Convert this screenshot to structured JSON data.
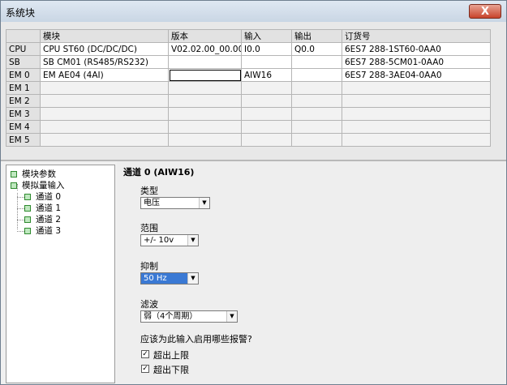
{
  "window": {
    "title": "系统块",
    "close_label": "X"
  },
  "grid": {
    "headers": [
      "模块",
      "版本",
      "输入",
      "输出",
      "订货号"
    ],
    "rows": [
      {
        "slot": "CPU",
        "module": "CPU ST60 (DC/DC/DC)",
        "version": "V02.02.00_00.00...",
        "input": "I0.0",
        "output": "Q0.0",
        "order": "6ES7 288-1ST60-0AA0"
      },
      {
        "slot": "SB",
        "module": "SB CM01 (RS485/RS232)",
        "version": "",
        "input": "",
        "output": "",
        "order": "6ES7 288-5CM01-0AA0"
      },
      {
        "slot": "EM 0",
        "module": "EM AE04 (4AI)",
        "version": "",
        "input": "AIW16",
        "output": "",
        "order": "6ES7 288-3AE04-0AA0"
      },
      {
        "slot": "EM 1",
        "module": "",
        "version": "",
        "input": "",
        "output": "",
        "order": ""
      },
      {
        "slot": "EM 2",
        "module": "",
        "version": "",
        "input": "",
        "output": "",
        "order": ""
      },
      {
        "slot": "EM 3",
        "module": "",
        "version": "",
        "input": "",
        "output": "",
        "order": ""
      },
      {
        "slot": "EM 4",
        "module": "",
        "version": "",
        "input": "",
        "output": "",
        "order": ""
      },
      {
        "slot": "EM 5",
        "module": "",
        "version": "",
        "input": "",
        "output": "",
        "order": ""
      }
    ]
  },
  "tree": {
    "module_params": "模块参数",
    "analog_input": "模拟量输入",
    "channels": [
      "通道 0",
      "通道 1",
      "通道 2",
      "通道 3"
    ]
  },
  "panel": {
    "title": "通道 0 (AIW16)",
    "type_label": "类型",
    "type_value": "电压",
    "range_label": "范围",
    "range_value": "+/- 10v",
    "reject_label": "抑制",
    "reject_value": "50 Hz",
    "filter_label": "滤波",
    "filter_value": "弱（4个周期）",
    "alarm_question": "应该为此输入启用哪些报警?",
    "alarms": [
      {
        "label": "超出上限",
        "checked": true
      },
      {
        "label": "超出下限",
        "checked": true
      }
    ]
  },
  "colors": {
    "selected_combo": "#3a79d4",
    "tree_icon": "#2f8a2f"
  }
}
